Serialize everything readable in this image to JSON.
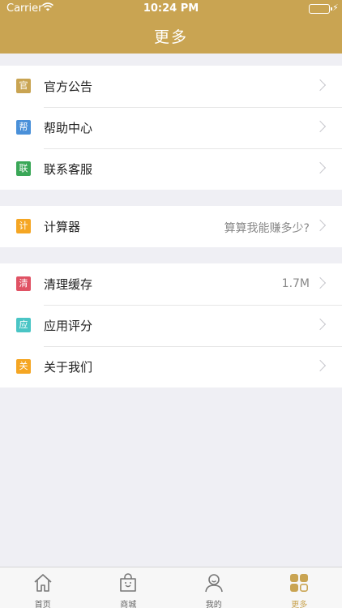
{
  "status": {
    "carrier": "Carrier",
    "time": "10:24 PM"
  },
  "nav": {
    "title": "更多"
  },
  "groups": [
    {
      "items": [
        {
          "badge": "官",
          "label": "官方公告",
          "value": "",
          "color": "#c9a452"
        },
        {
          "badge": "帮",
          "label": "帮助中心",
          "value": "",
          "color": "#4a90d9"
        },
        {
          "badge": "联",
          "label": "联系客服",
          "value": "",
          "color": "#3aa757"
        }
      ]
    },
    {
      "items": [
        {
          "badge": "计",
          "label": "计算器",
          "value": "算算我能赚多少?",
          "color": "#f5a623"
        }
      ]
    },
    {
      "items": [
        {
          "badge": "清",
          "label": "清理缓存",
          "value": "1.7M",
          "color": "#e05264"
        },
        {
          "badge": "应",
          "label": "应用评分",
          "value": "",
          "color": "#4ac5c5"
        },
        {
          "badge": "关",
          "label": "关于我们",
          "value": "",
          "color": "#f5a623"
        }
      ]
    }
  ],
  "tabs": [
    {
      "label": "首页",
      "icon": "home-icon"
    },
    {
      "label": "商城",
      "icon": "shopping-bag-icon"
    },
    {
      "label": "我的",
      "icon": "user-icon"
    },
    {
      "label": "更多",
      "icon": "grid-icon"
    }
  ],
  "colors": {
    "accent": "#c9a452"
  }
}
